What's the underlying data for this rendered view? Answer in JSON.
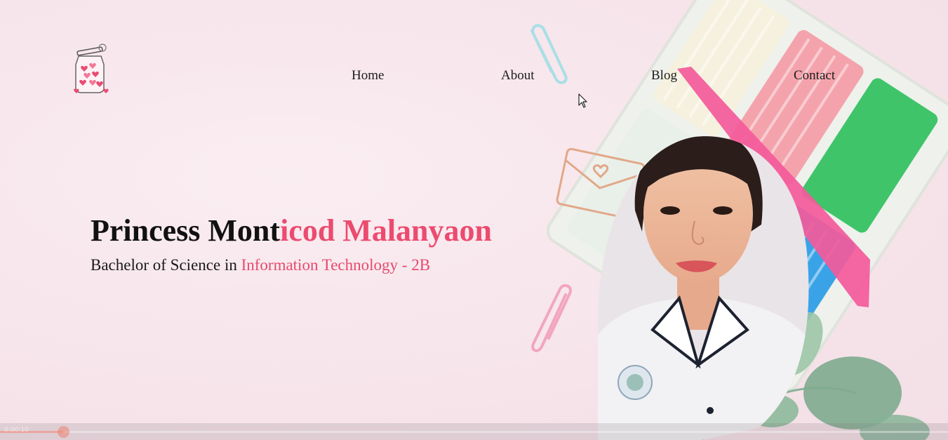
{
  "nav": {
    "home": "Home",
    "about": "About",
    "blog": "Blog",
    "contact": "Contact"
  },
  "hero": {
    "name_part1": "Princess Mont",
    "name_part2": "icod Malanyaon",
    "subtitle_part1": "Bachelor of Science in ",
    "subtitle_part2": "Information Technology - 2B"
  },
  "video": {
    "elapsed": "0:00:10"
  },
  "colors": {
    "accent": "#ec4b70",
    "background": "#f7e6ec",
    "text": "#111111"
  },
  "icons": {
    "logo": "heart-jar-icon",
    "cursor": "mouse-pointer-icon"
  }
}
